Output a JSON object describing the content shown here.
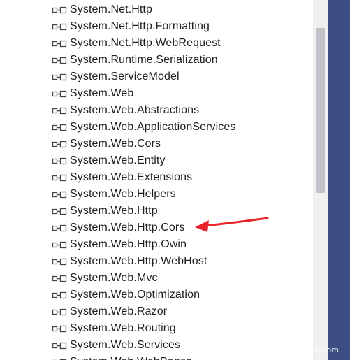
{
  "references": [
    "System.Net.Http",
    "System.Net.Http.Formatting",
    "System.Net.Http.WebRequest",
    "System.Runtime.Serialization",
    "System.ServiceModel",
    "System.Web",
    "System.Web.Abstractions",
    "System.Web.ApplicationServices",
    "System.Web.Cors",
    "System.Web.Entity",
    "System.Web.Extensions",
    "System.Web.Helpers",
    "System.Web.Http",
    "System.Web.Http.Cors",
    "System.Web.Http.Owin",
    "System.Web.Http.WebHost",
    "System.Web.Mvc",
    "System.Web.Optimization",
    "System.Web.Razor",
    "System.Web.Routing",
    "System.Web.Services",
    "System.Web.WebPages"
  ],
  "icon": "assembly-reference-icon",
  "highlighted_reference": "System.Web.Http.Cors",
  "watermark": "CSDN @JagTom",
  "colors": {
    "text": "#1e1e1e",
    "icon": "#444444",
    "arrow": "#e8242b",
    "side_panel": "#3d4f82",
    "scroll_track": "#f0f0f0",
    "scroll_thumb": "#c2c3c9"
  }
}
